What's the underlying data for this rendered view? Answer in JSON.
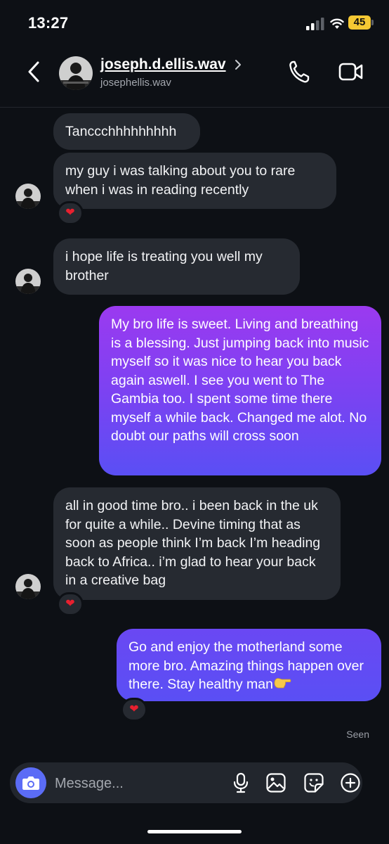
{
  "status_bar": {
    "time": "13:27",
    "battery": "45"
  },
  "header": {
    "display_name": "joseph.d.ellis.wav",
    "username": "josephellis.wav"
  },
  "messages": [
    {
      "from": "them",
      "text": "Tanccchhhhhhhhh"
    },
    {
      "from": "them",
      "text": "my guy i was talking about you to rare when i was in reading recently",
      "reaction": "heart"
    },
    {
      "from": "them",
      "text": "i hope life is treating you well my brother"
    },
    {
      "from": "me",
      "text": "My bro life is sweet. Living and breathing is a blessing. Just jumping back into music myself so it was nice to hear you back again aswell. I see you went to The Gambia too. I spent some time there myself a while back. Changed me alot. No doubt our paths will cross soon"
    },
    {
      "from": "them",
      "text": "all in good time bro.. i been back in the uk for quite a while.. Devine timing that as soon as people think I’m back I’m heading back to Africa.. i’m glad to hear your back in a creative bag",
      "reaction": "heart"
    },
    {
      "from": "me",
      "text": "Go and enjoy the motherland some more bro. Amazing things happen over there. Stay healthy man",
      "emoji": "pointing-hand",
      "reaction": "heart"
    }
  ],
  "seen": "Seen",
  "composer": {
    "placeholder": "Message..."
  },
  "colors": {
    "accent": "#5b6cf6",
    "bubble_in": "#262a31",
    "gradient_top": "#9b3af0",
    "gradient_bottom": "#5a4ff4"
  }
}
